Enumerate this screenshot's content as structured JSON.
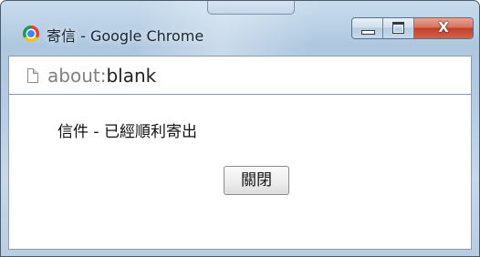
{
  "window": {
    "title": "寄信 - Google Chrome",
    "app_icon": "chrome-icon",
    "caption_buttons": {
      "minimize_icon": "minimize-icon",
      "maximize_icon": "maximize-icon",
      "close_glyph": "X"
    },
    "colors": {
      "close_button": "#c2402a",
      "frame": "#b5cce2"
    }
  },
  "addressbar": {
    "page_icon": "page-icon",
    "url_scheme": "about:",
    "url_host": "blank"
  },
  "content": {
    "message": "信件 - 已經順利寄出",
    "close_button_label": "關閉"
  }
}
